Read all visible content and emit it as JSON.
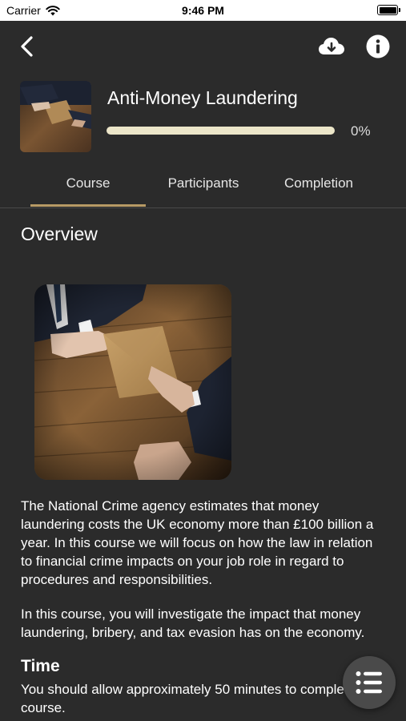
{
  "status_bar": {
    "carrier": "Carrier",
    "time": "9:46 PM"
  },
  "nav": {
    "back_icon": "chevron-left-icon",
    "download_icon": "cloud-download-icon",
    "info_icon": "info-icon"
  },
  "course": {
    "title": "Anti-Money Laundering",
    "progress_percent_label": "0%",
    "progress_fraction": 0
  },
  "tabs": [
    {
      "label": "Course",
      "active": true
    },
    {
      "label": "Participants",
      "active": false
    },
    {
      "label": "Completion",
      "active": false
    }
  ],
  "content": {
    "overview_title": "Overview",
    "paragraph_1": "The National Crime agency estimates that money laundering costs the UK economy more than £100 billion a year. In this course we will focus on how the law in relation to financial crime impacts on your job role in regard to procedures and responsibilities.",
    "paragraph_2": "In this course, you will investigate the impact that money laundering, bribery, and tax evasion has on the economy.",
    "time_title": "Time",
    "paragraph_3": "You should allow approximately 50 minutes to complete the course."
  },
  "fab": {
    "icon": "list-icon"
  },
  "colors": {
    "background": "#2b2b2b",
    "accent": "#b79a65",
    "progress_track": "#ece6c9"
  }
}
